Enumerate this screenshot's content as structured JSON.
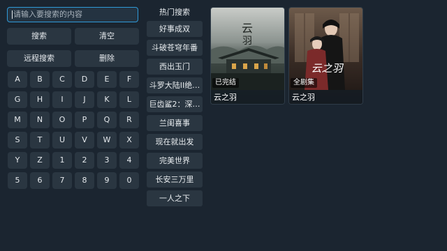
{
  "search": {
    "placeholder": "请输入要搜索的内容",
    "search_label": "搜索",
    "clear_label": "清空",
    "remote_label": "远程搜索",
    "delete_label": "删除"
  },
  "keyboard": {
    "keys": [
      "A",
      "B",
      "C",
      "D",
      "E",
      "F",
      "G",
      "H",
      "I",
      "J",
      "K",
      "L",
      "M",
      "N",
      "O",
      "P",
      "Q",
      "R",
      "S",
      "T",
      "U",
      "V",
      "W",
      "X",
      "Y",
      "Z",
      "1",
      "2",
      "3",
      "4",
      "5",
      "6",
      "7",
      "8",
      "9",
      "0"
    ]
  },
  "hot": {
    "title": "热门搜索",
    "items": [
      "好事成双",
      "斗破苍穹年番",
      "西出玉门",
      "斗罗大陆II绝…",
      "巨齿鲨2：深…",
      "兰闺喜事",
      "现在就出发",
      "完美世界",
      "长安三万里",
      "一人之下"
    ]
  },
  "results": [
    {
      "badge": "已完结",
      "title": "云之羽"
    },
    {
      "badge": "全剧集",
      "title": "云之羽"
    }
  ],
  "colors": {
    "background": "#1b2530",
    "button": "#2a3641",
    "accent": "#2f9ad8"
  }
}
